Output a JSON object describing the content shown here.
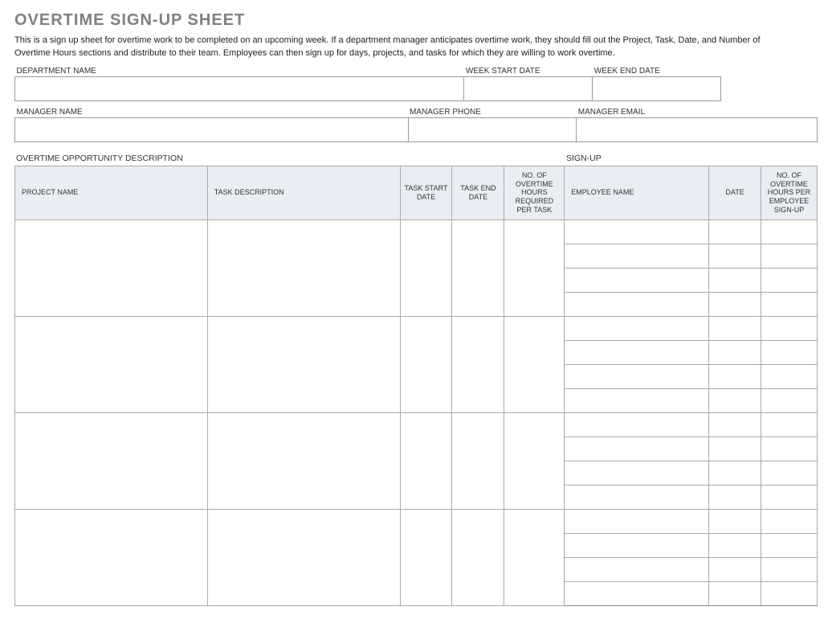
{
  "title": "OVERTIME SIGN-UP SHEET",
  "description": "This is a sign up sheet for overtime work to be completed on an upcoming week. If a department manager anticipates overtime work, they should fill out the Project, Task, Date, and Number of Overtime Hours sections and distribute to their team. Employees can then sign up for days, projects, and tasks for which they are willing to work overtime.",
  "header": {
    "dept_label": "DEPARTMENT NAME",
    "week_start_label": "WEEK START DATE",
    "week_end_label": "WEEK END DATE",
    "dept_value": "",
    "week_start_value": "",
    "week_end_value": "",
    "mgr_name_label": "MANAGER NAME",
    "mgr_phone_label": "MANAGER PHONE",
    "mgr_email_label": "MANAGER EMAIL",
    "mgr_name_value": "",
    "mgr_phone_value": "",
    "mgr_email_value": ""
  },
  "sections": {
    "opportunity": "OVERTIME OPPORTUNITY DESCRIPTION",
    "signup": "SIGN-UP"
  },
  "columns": {
    "project": "PROJECT NAME",
    "task": "TASK DESCRIPTION",
    "task_start": "TASK START DATE",
    "task_end": "TASK END DATE",
    "hours_req": "NO. OF OVERTIME HOURS REQUIRED PER TASK",
    "employee": "EMPLOYEE NAME",
    "date": "DATE",
    "hours_signup": "NO. OF OVERTIME HOURS PER EMPLOYEE SIGN-UP"
  },
  "groups": 4,
  "rows_per_group": 4
}
